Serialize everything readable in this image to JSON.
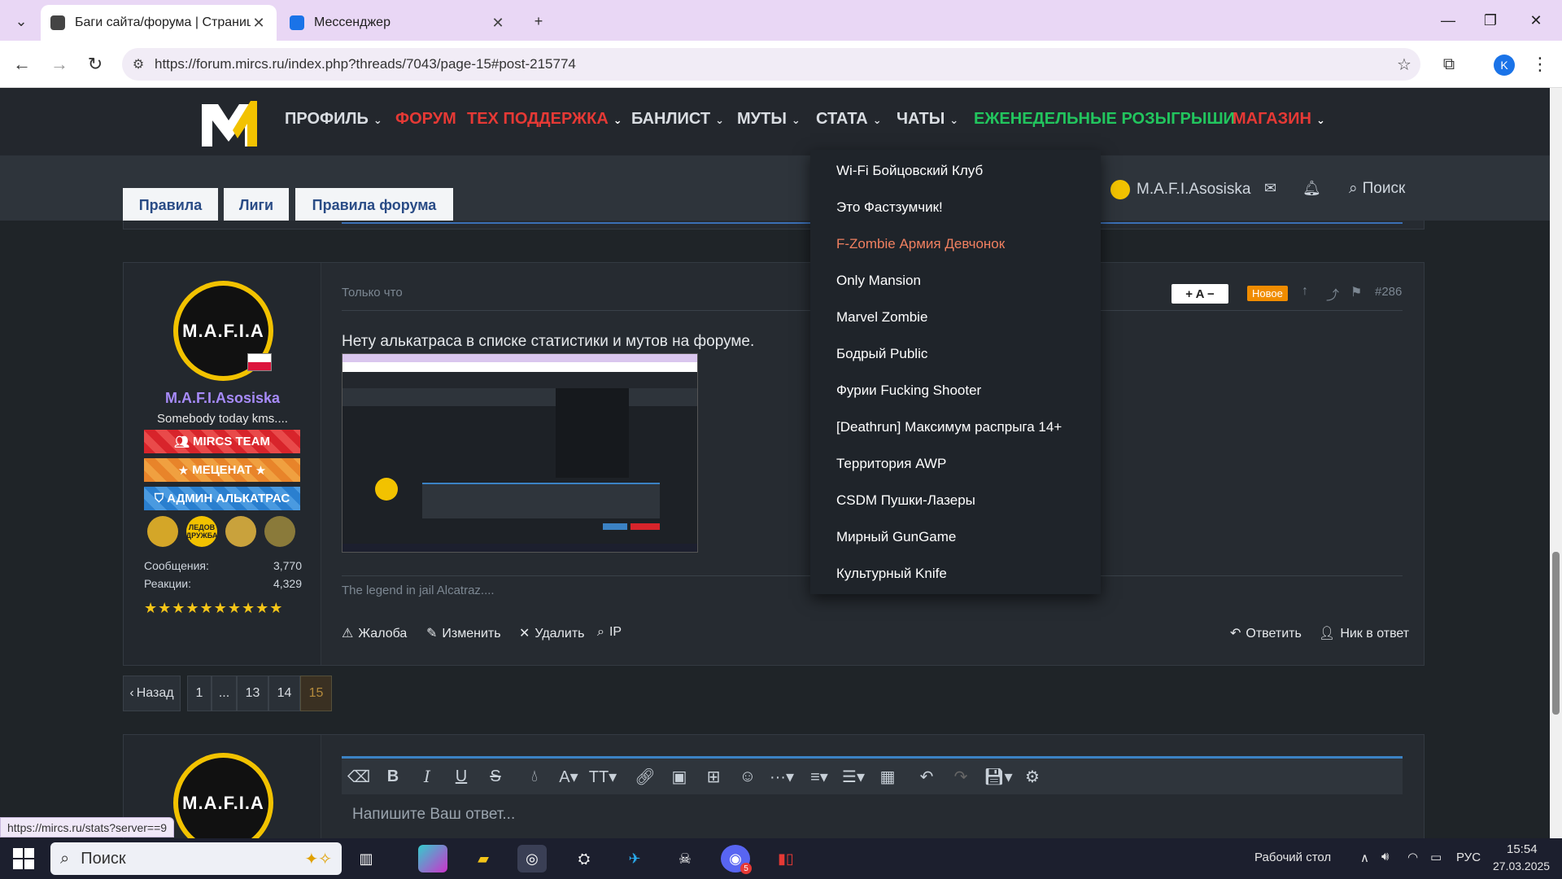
{
  "browser": {
    "tabs": [
      {
        "title": "Баги сайта/форума | Страница",
        "active": true
      },
      {
        "title": "Мессенджер",
        "active": false
      }
    ],
    "url": "https://forum.mircs.ru/index.php?threads/7043/page-15#post-215774",
    "profile_initial": "K"
  },
  "site": {
    "nav": [
      {
        "label": "ПРОФИЛЬ",
        "color": "#ffffff",
        "caret": true
      },
      {
        "label": "ФОРУМ",
        "color": "#e53935",
        "caret": false
      },
      {
        "label": "ТЕХ ПОДДЕРЖКА",
        "color": "#e53935",
        "caret": true
      },
      {
        "label": "БАНЛИСТ",
        "color": "#ffffff",
        "caret": true
      },
      {
        "label": "МУТЫ",
        "color": "#ffffff",
        "caret": true
      },
      {
        "label": "СТАТА",
        "color": "#ffffff",
        "caret": true
      },
      {
        "label": "ЧАТЫ",
        "color": "#ffffff",
        "caret": true
      },
      {
        "label": "ЕЖЕНЕДЕЛЬНЫЕ РОЗЫГРЫШИ",
        "color": "#22c55e",
        "caret": false
      },
      {
        "label": "МАГАЗИН",
        "color": "#e53935",
        "caret": true
      }
    ],
    "subnav": [
      "Правила",
      "Лиги",
      "Правила форума"
    ],
    "header_user": "M.A.F.I.Asosiska",
    "search_label": "Поиск"
  },
  "dropdown": {
    "items": [
      {
        "label": "Wi-Fi Бойцовский Клуб",
        "color": "#ffffff"
      },
      {
        "label": "Это Фастзумчик!",
        "color": "#ffffff"
      },
      {
        "label": "F-Zombie Армия Девчонок",
        "color": "#f08060"
      },
      {
        "label": "Only Mansion",
        "color": "#ffffff"
      },
      {
        "label": "Marvel Zombie",
        "color": "#ffffff"
      },
      {
        "label": "Бодрый Public",
        "color": "#ffffff"
      },
      {
        "label": "Фурии Fucking Shooter",
        "color": "#ffffff"
      },
      {
        "label": "[Deathrun] Максимум распрыга 14+",
        "color": "#ffffff"
      },
      {
        "label": "Территория AWP",
        "color": "#ffffff"
      },
      {
        "label": "CSDM Пушки-Лазеры",
        "color": "#ffffff"
      },
      {
        "label": "Мирный GunGame",
        "color": "#ffffff"
      },
      {
        "label": "Культурный Knife",
        "color": "#ffffff"
      }
    ]
  },
  "post": {
    "avatar_text": "M.A.F.I.A",
    "username": "M.A.F.I.Asosiska",
    "user_title": "Somebody today kms....",
    "banners": [
      "MIRCS TEAM",
      "МЕЦЕНАТ",
      "АДМИН АЛЬКАТРАС"
    ],
    "medals": [
      "",
      "ЛЕДОВ ДРУЖБА",
      "",
      ""
    ],
    "stats": [
      {
        "label": "Сообщения:",
        "value": "3,770"
      },
      {
        "label": "Реакции:",
        "value": "4,329"
      }
    ],
    "stars": "★★★★★★★★★★",
    "time": "Только что",
    "font_ctl": "+ A −",
    "new_badge": "Новое",
    "number": "#286",
    "text": "Нету алькатраса в списке статистики и мутов на форуме.",
    "signature": "The legend in jail Alcatraz....",
    "actions": [
      "Жалоба",
      "Изменить",
      "Удалить",
      "IP"
    ],
    "actions_right": [
      "Ответить",
      "Ник в ответ"
    ]
  },
  "pager": {
    "prev": "Назад",
    "pages": [
      "1",
      "...",
      "13",
      "14",
      "15"
    ],
    "current": "15"
  },
  "reply": {
    "placeholder": "Напишите Ваш ответ..."
  },
  "status_url": "https://mircs.ru/stats?server==9",
  "taskbar": {
    "search": "Поиск",
    "desktop": "Рабочий стол",
    "lang": "РУС",
    "time": "15:54",
    "date": "27.03.2025",
    "discord_badge": "5"
  }
}
